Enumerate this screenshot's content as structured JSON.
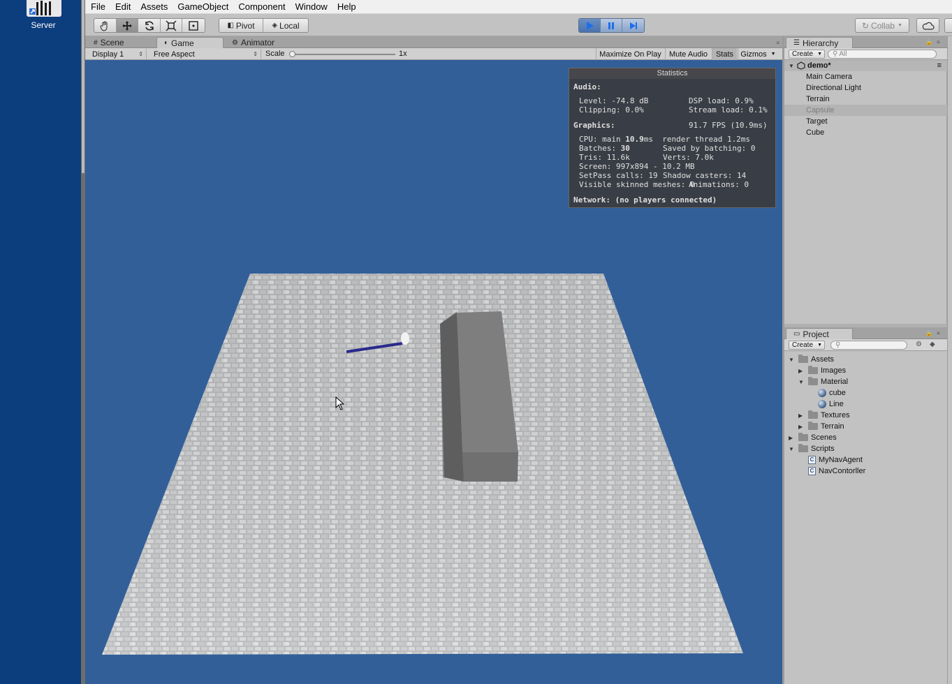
{
  "desktop": {
    "icon_label": "Server"
  },
  "menubar": [
    "File",
    "Edit",
    "Assets",
    "GameObject",
    "Component",
    "Window",
    "Help"
  ],
  "toolbar": {
    "transform_tools": [
      "hand-icon",
      "move-icon",
      "rotate-icon",
      "scale-icon",
      "rect-icon"
    ],
    "pivot_label": "Pivot",
    "local_label": "Local",
    "collab_label": "Collab",
    "play_state": "playing",
    "accent": "#4a71ab"
  },
  "tabs": {
    "scene": "Scene",
    "game": "Game",
    "animator": "Animator",
    "hierarchy": "Hierarchy",
    "project": "Project"
  },
  "gamebar": {
    "display": "Display 1",
    "aspect": "Free Aspect",
    "scale_label": "Scale",
    "scale_value": "1x",
    "maximize": "Maximize On Play",
    "mute": "Mute Audio",
    "stats": "Stats",
    "gizmos": "Gizmos"
  },
  "statistics": {
    "title": "Statistics",
    "audio_heading": "Audio:",
    "level": "Level: -74.8 dB",
    "dsp": "DSP load: 0.9%",
    "clipping": "Clipping: 0.0%",
    "stream": "Stream load: 0.1%",
    "graphics_heading": "Graphics:",
    "fps": "91.7 FPS (10.9ms)",
    "cpu_prefix": "CPU: main ",
    "cpu_main": "10.9",
    "cpu_suffix": "ms  render thread 1.2ms",
    "batches_prefix": "Batches: ",
    "batches": "30",
    "saved_batching": "Saved by batching: 0",
    "tris": "Tris: 11.6k",
    "verts": "Verts: 7.0k",
    "screen": "Screen: 997x894 - 10.2 MB",
    "setpass": "SetPass calls: 19",
    "shadow": "Shadow casters: 14",
    "skinned": "Visible skinned meshes: 0",
    "animations": "Animations: 0",
    "network": "Network: (no players connected)"
  },
  "hierarchy": {
    "create_label": "Create",
    "search_placeholder": "All",
    "scene_name": "demo*",
    "items": [
      "Main Camera",
      "Directional Light",
      "Terrain",
      "Capsule",
      "Target",
      "Cube"
    ],
    "disabled_item": "Capsule"
  },
  "project": {
    "create_label": "Create",
    "tree": [
      {
        "label": "Assets",
        "depth": 0,
        "type": "folder",
        "expanded": true
      },
      {
        "label": "Images",
        "depth": 1,
        "type": "folder",
        "expanded": false
      },
      {
        "label": "Material",
        "depth": 1,
        "type": "folder",
        "expanded": true
      },
      {
        "label": "cube",
        "depth": 2,
        "type": "material"
      },
      {
        "label": "Line",
        "depth": 2,
        "type": "material"
      },
      {
        "label": "Textures",
        "depth": 1,
        "type": "folder",
        "expanded": false
      },
      {
        "label": "Terrain",
        "depth": 1,
        "type": "terrain",
        "expanded": false
      },
      {
        "label": "Scenes",
        "depth": 0,
        "type": "folder",
        "expanded": false
      },
      {
        "label": "Scripts",
        "depth": 0,
        "type": "folder",
        "expanded": true
      },
      {
        "label": "MyNavAgent",
        "depth": 1,
        "type": "script"
      },
      {
        "label": "NavContorller",
        "depth": 1,
        "type": "script"
      }
    ]
  },
  "colors": {
    "viewport_bg": "#325f98",
    "desktop_bg": "#0c3d7d",
    "nav_line": "#2a2a8c",
    "cube": "#7b7b7b"
  }
}
